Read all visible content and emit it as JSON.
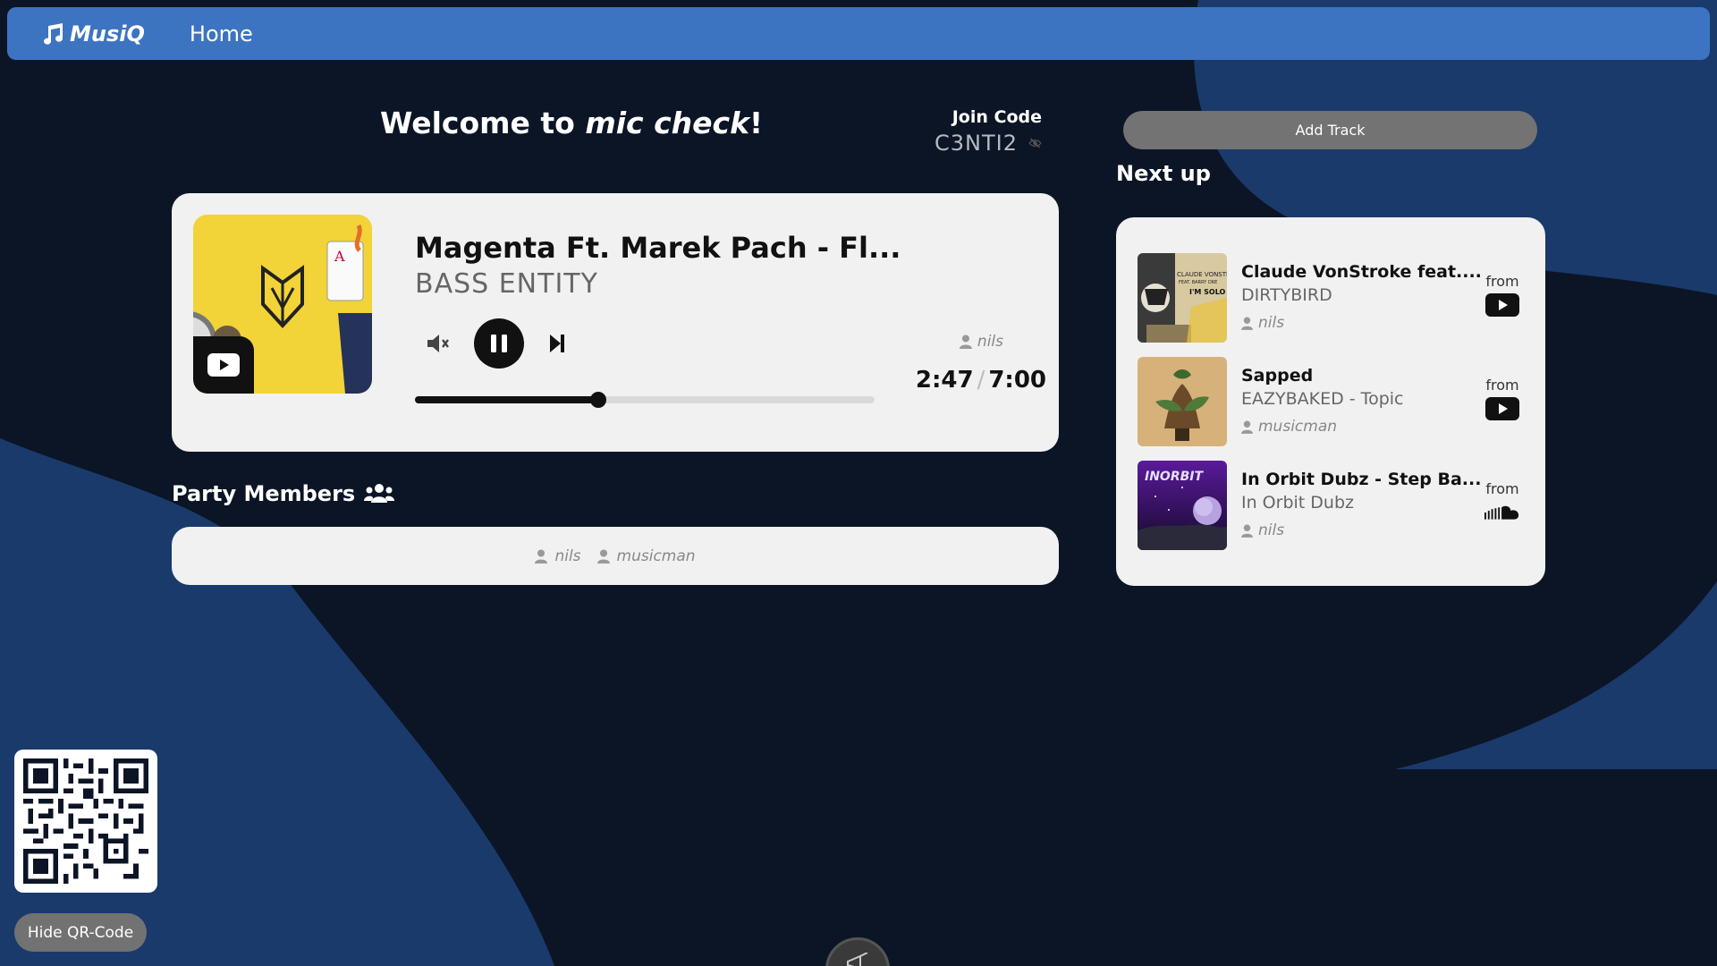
{
  "colors": {
    "navbar": "#3d74c1",
    "background": "#0c1526",
    "blob": "#1a3a6b",
    "card": "#f1f1f1"
  },
  "nav": {
    "brand": "MusiQ",
    "home": "Home"
  },
  "welcome": {
    "prefix": "Welcome to ",
    "party_name": "mic check",
    "suffix": "!"
  },
  "join": {
    "label": "Join Code",
    "code": "C3NTI2",
    "toggle_icon": "eye-slash-icon"
  },
  "now_playing": {
    "title": "Magenta Ft. Marek Pach - Fl...",
    "artist": "BASS ENTITY",
    "requested_by": "nils",
    "elapsed": "2:47",
    "separator": "/",
    "duration": "7:00",
    "progress_fraction": 0.398,
    "source_icon": "youtube-icon"
  },
  "party": {
    "title": "Party Members",
    "members": [
      "nils",
      "musicman"
    ]
  },
  "queue": {
    "add_label": "Add Track",
    "title": "Next up",
    "from_label": "from",
    "items": [
      {
        "title": "Claude VonStroke feat....",
        "artist": "DIRTYBIRD",
        "user": "nils",
        "source": "youtube",
        "thumb_text_1": "CLAUDE VONSTR",
        "thumb_text_2": "FEAT. BARRY DRE",
        "thumb_text_3": "I'M SOLO"
      },
      {
        "title": "Sapped",
        "artist": "EAZYBAKED - Topic",
        "user": "musicman",
        "source": "youtube"
      },
      {
        "title": "In Orbit Dubz - Step Ba...",
        "artist": "In Orbit Dubz",
        "user": "nils",
        "source": "soundcloud",
        "thumb_text_1": "INORBIT"
      }
    ]
  },
  "qr": {
    "hide_label": "Hide QR-Code"
  }
}
